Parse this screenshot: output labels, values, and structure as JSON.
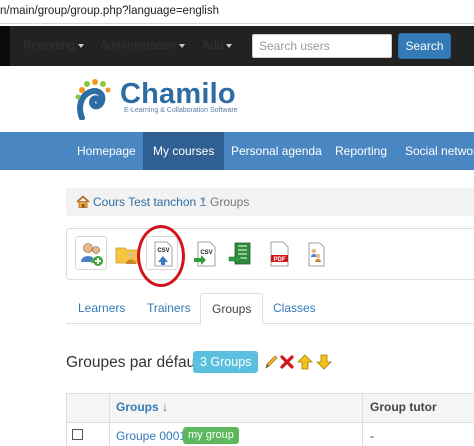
{
  "browser": {
    "url": "n/main/group/group.php?language=english"
  },
  "topbar": {
    "menus": [
      {
        "label": "Reporting"
      },
      {
        "label": "Administration"
      },
      {
        "label": "Add"
      }
    ],
    "search_placeholder": "Search users",
    "search_button": "Search"
  },
  "branding": {
    "name": "Chamilo",
    "tagline": "E-Learning & Collaboration Software",
    "colors": {
      "primary": "#2e6da4",
      "green": "#8cc63f",
      "orange": "#f7941d"
    }
  },
  "nav": {
    "items": [
      {
        "label": "Homepage"
      },
      {
        "label": "My courses",
        "active": true
      },
      {
        "label": "Personal agenda"
      },
      {
        "label": "Reporting"
      },
      {
        "label": "Social network"
      }
    ]
  },
  "breadcrumb": {
    "course": "Cours Test tanchon 1",
    "separator": "/",
    "current": "Groups"
  },
  "toolbar": {
    "tools": [
      {
        "icon": "add-group-icon"
      },
      {
        "icon": "group-category-folder-icon"
      },
      {
        "icon": "import-csv-icon"
      },
      {
        "icon": "export-csv-icon"
      },
      {
        "icon": "export-xls-icon"
      },
      {
        "icon": "export-pdf-icon"
      },
      {
        "icon": "group-overview-icon"
      }
    ]
  },
  "tabs": {
    "items": [
      {
        "label": "Learners"
      },
      {
        "label": "Trainers"
      },
      {
        "label": "Groups",
        "active": true
      },
      {
        "label": "Classes"
      }
    ]
  },
  "groups_section": {
    "title": "Groupes par défaut",
    "count": "3 Groups",
    "actions": [
      "edit-icon",
      "delete-icon",
      "move-up-icon",
      "move-down-icon"
    ]
  },
  "groups_table": {
    "headers": [
      "Groups ↓",
      "Group tutor"
    ],
    "rows": [
      {
        "name": "Groupe 0001",
        "tag": "my group",
        "tutor": "-"
      }
    ]
  }
}
